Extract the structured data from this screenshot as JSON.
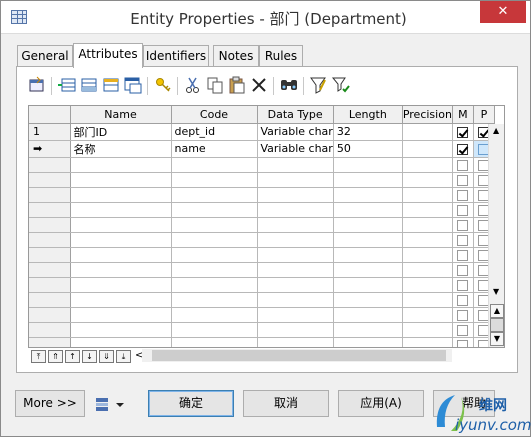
{
  "window": {
    "title": "Entity Properties - 部门 (Department)",
    "close_glyph": "✕"
  },
  "tabs": [
    {
      "label": "General"
    },
    {
      "label": "Attributes"
    },
    {
      "label": "Identifiers"
    },
    {
      "label": "Notes"
    },
    {
      "label": "Rules"
    }
  ],
  "active_tab": "Attributes",
  "toolbar": {
    "icons": [
      "properties-icon",
      "insert-row-icon",
      "add-row-icon",
      "add-attributes-icon",
      "reuse-attributes-icon",
      "new-key-icon",
      "cut-icon",
      "copy-icon",
      "paste-icon",
      "delete-icon",
      "find-icon",
      "filter-icon",
      "filter-settings-icon"
    ]
  },
  "grid": {
    "columns": [
      "Name",
      "Code",
      "Data Type",
      "Length",
      "Precision",
      "M",
      "P"
    ],
    "rows": [
      {
        "marker": "1",
        "name": "部门ID",
        "code": "dept_id",
        "data_type": "Variable char",
        "length": "32",
        "precision": "",
        "m": true,
        "p": true
      },
      {
        "marker": "➡",
        "name": "名称",
        "code": "name",
        "data_type": "Variable char",
        "length": "50",
        "precision": "",
        "m": true,
        "p": false
      }
    ],
    "empty_rows": 14
  },
  "buttons": {
    "more": "More >>",
    "ok": "确定",
    "cancel": "取消",
    "apply": "应用(A)",
    "help_partial": "帮助"
  },
  "watermark": {
    "cn_text": "维网",
    "url": "iyunv.com"
  },
  "colors": {
    "title_close_bg": "#c7373a",
    "selected_cell": "#cfe7fb"
  }
}
